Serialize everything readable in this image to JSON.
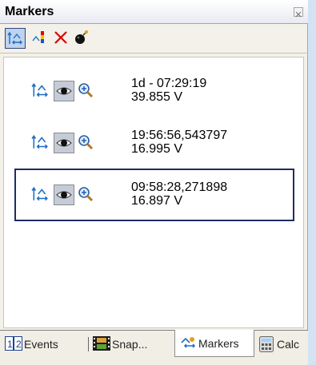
{
  "panel": {
    "title": "Markers"
  },
  "toolbar": {
    "buttons": [
      {
        "icon": "marker-arrows-icon",
        "selected": true
      },
      {
        "icon": "marker-color-icon"
      },
      {
        "icon": "delete-x-icon",
        "color": "#e00000"
      },
      {
        "icon": "bomb-icon"
      }
    ]
  },
  "markers": [
    {
      "time": "1d - 07:29:19",
      "value": "39.855 V",
      "selected": false
    },
    {
      "time": "19:56:56,543797",
      "value": "16.995 V",
      "selected": false
    },
    {
      "time": "09:58:28,271898",
      "value": "16.897 V",
      "selected": true
    }
  ],
  "tabs": [
    {
      "label": "Events",
      "icon": "events-12-icon",
      "active": false
    },
    {
      "label": "Snap...",
      "icon": "snapshot-film-icon",
      "active": false
    },
    {
      "label": "Markers",
      "icon": "markers-icon",
      "active": true
    },
    {
      "label": "Calc",
      "icon": "calculator-icon",
      "active": false
    }
  ],
  "colors": {
    "selection_border": "#1f2b66",
    "panel_bg": "#f3f1e9",
    "toolbar_selected": "#c0d3ee"
  }
}
